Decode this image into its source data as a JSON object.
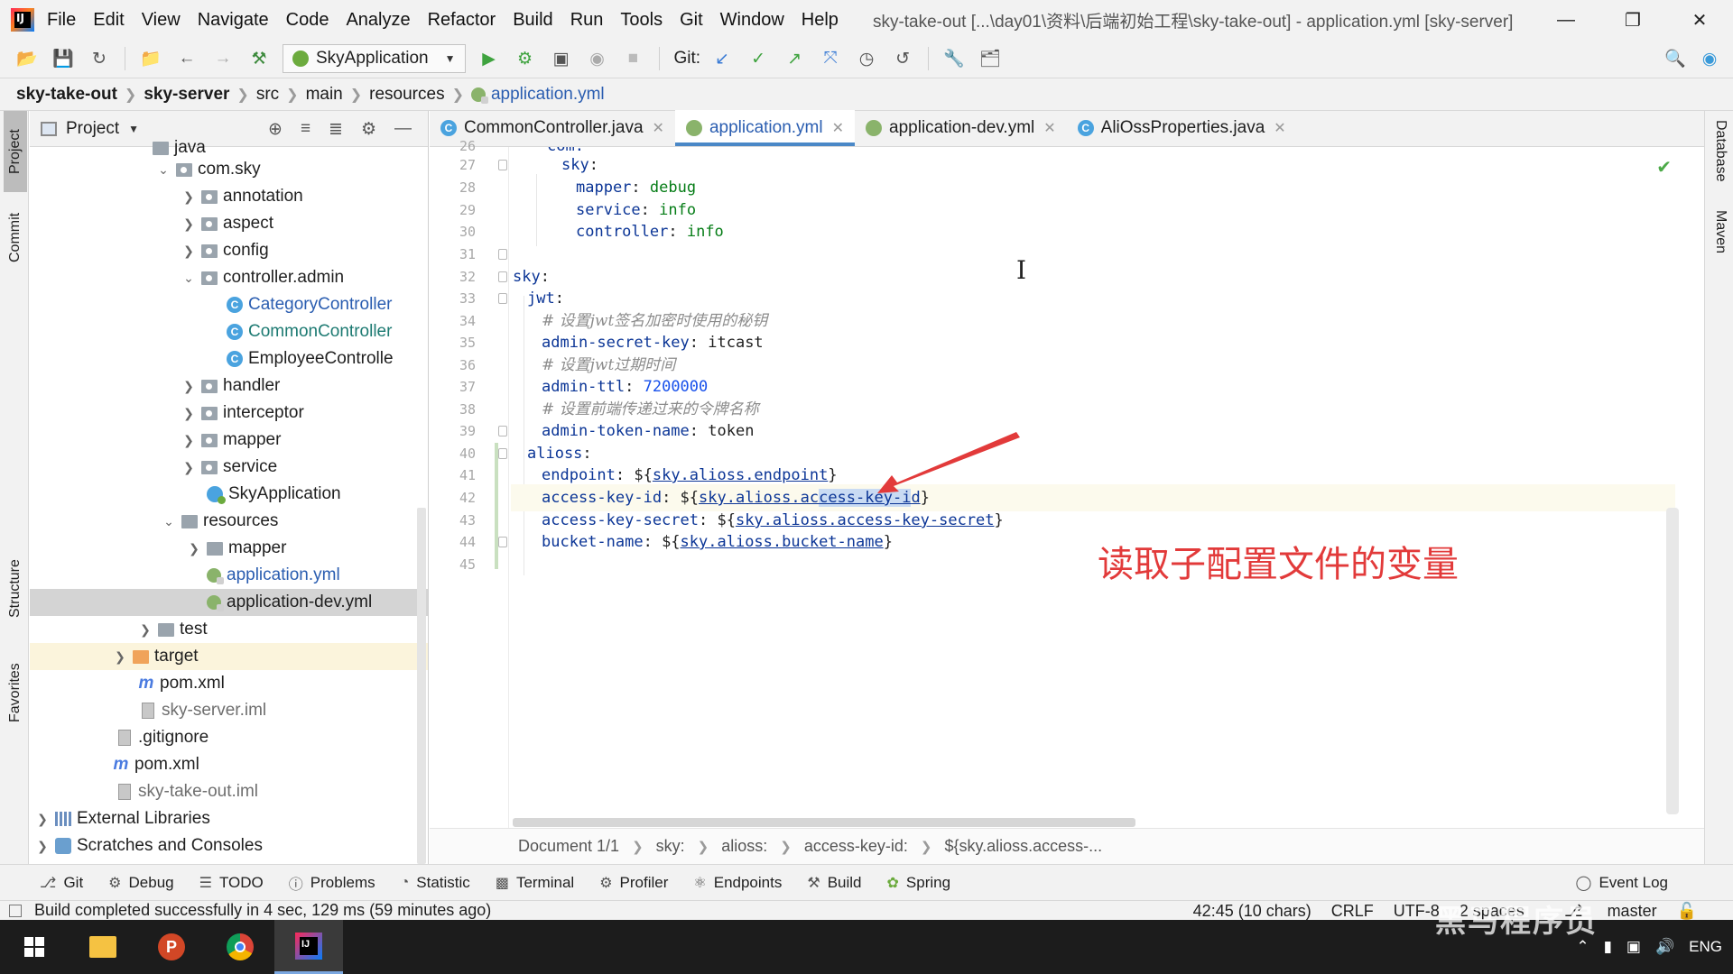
{
  "menu": {
    "items": [
      "File",
      "Edit",
      "View",
      "Navigate",
      "Code",
      "Analyze",
      "Refactor",
      "Build",
      "Run",
      "Tools",
      "Git",
      "Window",
      "Help"
    ],
    "title": "sky-take-out [...\\day01\\资料\\后端初始工程\\sky-take-out] - application.yml [sky-server]"
  },
  "toolbar": {
    "run_config": "SkyApplication",
    "git_label": "Git:"
  },
  "breadcrumb": {
    "items": [
      "sky-take-out",
      "sky-server",
      "src",
      "main",
      "resources"
    ],
    "file": "application.yml"
  },
  "left_strip": {
    "project": "Project",
    "commit": "Commit",
    "structure": "Structure",
    "favorites": "Favorites"
  },
  "right_strip": {
    "database": "Database",
    "maven": "Maven"
  },
  "project_panel": {
    "title": "Project",
    "tree": [
      "java",
      "com.sky",
      "annotation",
      "aspect",
      "config",
      "controller.admin",
      "CategoryController",
      "CommonController",
      "EmployeeControlle",
      "handler",
      "interceptor",
      "mapper",
      "service",
      "SkyApplication",
      "resources",
      "mapper",
      "application.yml",
      "application-dev.yml",
      "test",
      "target",
      "pom.xml",
      "sky-server.iml",
      ".gitignore",
      "pom.xml",
      "sky-take-out.iml",
      "External Libraries",
      "Scratches and Consoles"
    ]
  },
  "editor": {
    "tabs": [
      "CommonController.java",
      "application.yml",
      "application-dev.yml",
      "AliOssProperties.java"
    ],
    "line_numbers": [
      "26",
      "27",
      "28",
      "29",
      "30",
      "31",
      "32",
      "33",
      "34",
      "35",
      "36",
      "37",
      "38",
      "39",
      "40",
      "41",
      "42",
      "43",
      "44",
      "45"
    ],
    "lines": {
      "l26": "com:",
      "l27_key": "sky",
      "l28_key": "mapper",
      "l28_val": "debug",
      "l29_key": "service",
      "l29_val": "info",
      "l30_key": "controller",
      "l30_val": "info",
      "l32_key": "sky",
      "l33_key": "jwt",
      "l34_comment": "# 设置jwt签名加密时使用的秘钥",
      "l35_key": "admin-secret-key",
      "l35_val": "itcast",
      "l36_comment": "# 设置jwt过期时间",
      "l37_key": "admin-ttl",
      "l37_val": "7200000",
      "l38_comment": "# 设置前端传递过来的令牌名称",
      "l39_key": "admin-token-name",
      "l39_val": "token",
      "l40_key": "alioss",
      "l41_key": "endpoint",
      "l41_ref": "sky.alioss.endpoint",
      "l42_key": "access-key-id",
      "l42_ref_a": "sky.alioss.ac",
      "l42_ref_sel": "cess-key-i",
      "l42_ref_b": "d",
      "l43_key": "access-key-secret",
      "l43_ref": "sky.alioss.access-key-secret",
      "l44_key": "bucket-name",
      "l44_ref": "sky.alioss.bucket-name"
    },
    "annotation": "读取子配置文件的变量",
    "crumbs": [
      "Document 1/1",
      "sky:",
      "alioss:",
      "access-key-id:",
      "${sky.alioss.access-..."
    ]
  },
  "bottom_tools": [
    "Git",
    "Debug",
    "TODO",
    "Problems",
    "Statistic",
    "Terminal",
    "Profiler",
    "Endpoints",
    "Build",
    "Spring",
    "Event Log"
  ],
  "status": {
    "message": "Build completed successfully in 4 sec, 129 ms (59 minutes ago)",
    "position": "42:45 (10 chars)",
    "line_sep": "CRLF",
    "encoding": "UTF-8",
    "indent": "2 spaces",
    "branch": "master"
  },
  "taskbar": {
    "lang": "ENG",
    "watermark": "黑马程序员"
  },
  "colors": {
    "accent": "#4a88c7",
    "annotation": "#e23a3a",
    "key": "#0b3596",
    "string": "#067d17"
  }
}
